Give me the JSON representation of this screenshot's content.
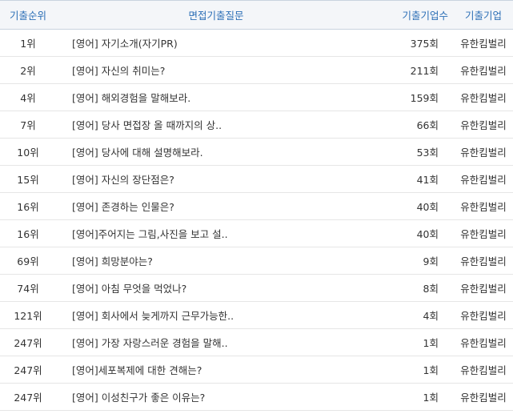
{
  "table": {
    "headers": {
      "rank": "기출순위",
      "question": "면접기출질문",
      "count": "기출기업수",
      "company": "기출기업"
    },
    "rows": [
      {
        "rank": "1위",
        "question": "[영어] 자기소개(자기PR)",
        "count": "375회",
        "company": "유한킴벌리"
      },
      {
        "rank": "2위",
        "question": "[영어] 자신의 취미는?",
        "count": "211회",
        "company": "유한킴벌리"
      },
      {
        "rank": "4위",
        "question": "[영어] 해외경험을 말해보라.",
        "count": "159회",
        "company": "유한킴벌리"
      },
      {
        "rank": "7위",
        "question": "[영어] 당사 면접장 올 때까지의 상..",
        "count": "66회",
        "company": "유한킴벌리"
      },
      {
        "rank": "10위",
        "question": "[영어] 당사에 대해 설명해보라.",
        "count": "53회",
        "company": "유한킴벌리"
      },
      {
        "rank": "15위",
        "question": "[영어] 자신의 장단점은?",
        "count": "41회",
        "company": "유한킴벌리"
      },
      {
        "rank": "16위",
        "question": "[영어] 존경하는 인물은?",
        "count": "40회",
        "company": "유한킴벌리"
      },
      {
        "rank": "16위",
        "question": "[영어]주어지는 그림,사진을 보고 설..",
        "count": "40회",
        "company": "유한킴벌리"
      },
      {
        "rank": "69위",
        "question": "[영어] 희망분야는?",
        "count": "9회",
        "company": "유한킴벌리"
      },
      {
        "rank": "74위",
        "question": "[영어] 아침 무엇을 먹었나?",
        "count": "8회",
        "company": "유한킴벌리"
      },
      {
        "rank": "121위",
        "question": "[영어] 회사에서 늦게까지 근무가능한..",
        "count": "4회",
        "company": "유한킴벌리"
      },
      {
        "rank": "247위",
        "question": "[영어] 가장 자랑스러운 경험을 말해..",
        "count": "1회",
        "company": "유한킴벌리"
      },
      {
        "rank": "247위",
        "question": "[영어]세포복제에 대한 견해는?",
        "count": "1회",
        "company": "유한킴벌리"
      },
      {
        "rank": "247위",
        "question": "[영어] 이성친구가 좋은 이유는?",
        "count": "1회",
        "company": "유한킴벌리"
      }
    ]
  }
}
